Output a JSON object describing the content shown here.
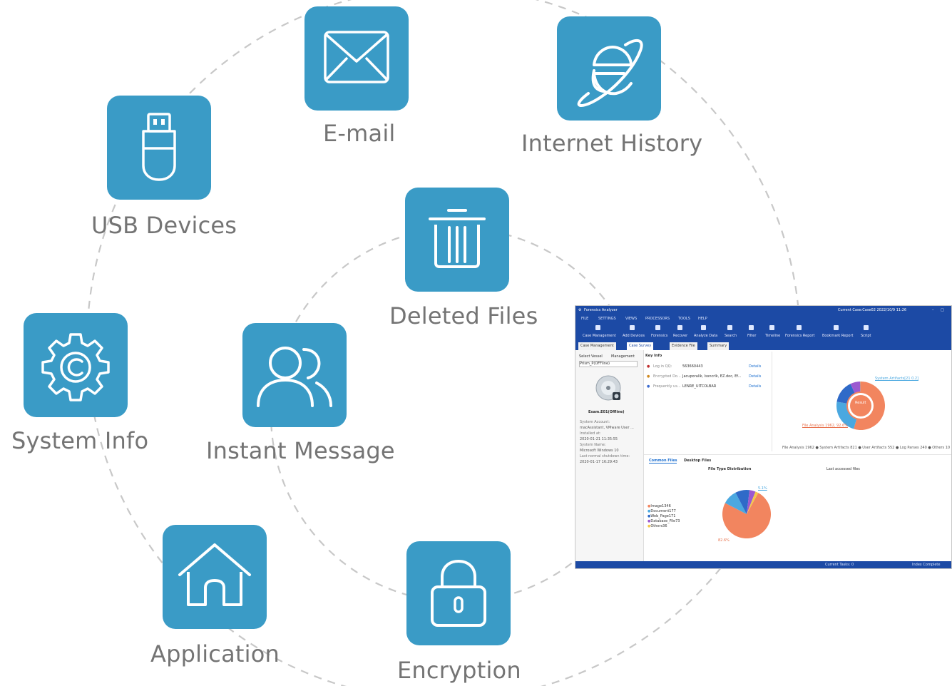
{
  "categories": {
    "email": "E-mail",
    "internet_history": "Internet History",
    "usb_devices": "USB Devices",
    "deleted_files": "Deleted Files",
    "system_info": "System Info",
    "instant_message": "Instant Message",
    "application": "Application",
    "encryption": "Encryption"
  },
  "colors": {
    "tile": "#3a9bc6",
    "label": "#747474",
    "dash": "#c8c8c8",
    "app_blue": "#1c4aa5"
  },
  "icons": {
    "email": "envelope-icon",
    "internet_history": "internet-explorer-icon",
    "usb_devices": "usb-drive-icon",
    "deleted_files": "trash-icon",
    "system_info": "gear-icon",
    "instant_message": "users-icon",
    "application": "home-icon",
    "encryption": "padlock-icon"
  },
  "app": {
    "title": "Forensics Analyzer",
    "case": "Current Case:Case02 2022/10/9 11:26",
    "menu": [
      "FILE",
      "SETTINGS",
      "VIEWS",
      "PROCESSORS",
      "TOOLS",
      "HELP"
    ],
    "toolbar": [
      "Case Management",
      "Add Devices",
      "Forensics",
      "Recover",
      "Analyze Data",
      "Search",
      "Filter",
      "Timeline",
      "Forensics Report",
      "Bookmark Report",
      "Script"
    ],
    "tabs": [
      "Case Management",
      "Case Survey",
      "Evidence File",
      "Summary"
    ],
    "left": {
      "select_vessel": "Select Vessel",
      "management": "Management",
      "dropdown": "Prism_P(OFFline)",
      "disk_label": "Exam.E01(Offline)",
      "lines": [
        "System Account:",
        "macAssistant, VMware User ...",
        "Installed at:",
        "2020-01-21 11:35:55",
        "System Name:",
        "Microsoft Windows 10",
        "Last normal shutdown time:",
        "2020-01-17 16:29:43"
      ]
    },
    "key_info": {
      "heading": "Key Info",
      "rows": [
        {
          "label": "Log in QQ:",
          "value": "563660443",
          "link": "Details"
        },
        {
          "label": "Encrypted Do...",
          "value": "Jacuporalik, Issncrlk, EZ.doc, Ef...",
          "link": "Details"
        },
        {
          "label": "Frequently us...",
          "value": "LENRE_UITCOLBAR",
          "link": "Details"
        }
      ]
    },
    "donut": {
      "center": "Result",
      "callout_top": "System Artifacts[21 0.2]",
      "callout_bottom": "File Analysis 1962, 92.6%",
      "legend": "File Analysis 1962 ● System Artifacts 821 ● User Artifacts 552 ● Log Parses 240 ● Others 10",
      "values": [
        1962,
        821,
        552,
        240,
        10
      ]
    },
    "lower_tabs": [
      "Common Files",
      "Desktop Files"
    ],
    "pie": {
      "title": "File Type Distribution",
      "last_accessed": "Last accessed files",
      "legend": [
        "Image1346",
        "Document177",
        "Web_Page171",
        "Database_File73",
        "Others36"
      ],
      "values": [
        1346,
        177,
        171,
        73,
        36
      ],
      "callout_small": "5.1%",
      "callout_big": "82.6%"
    },
    "status": {
      "tasks": "Current Tasks: 0",
      "state": "Index Complete"
    }
  }
}
